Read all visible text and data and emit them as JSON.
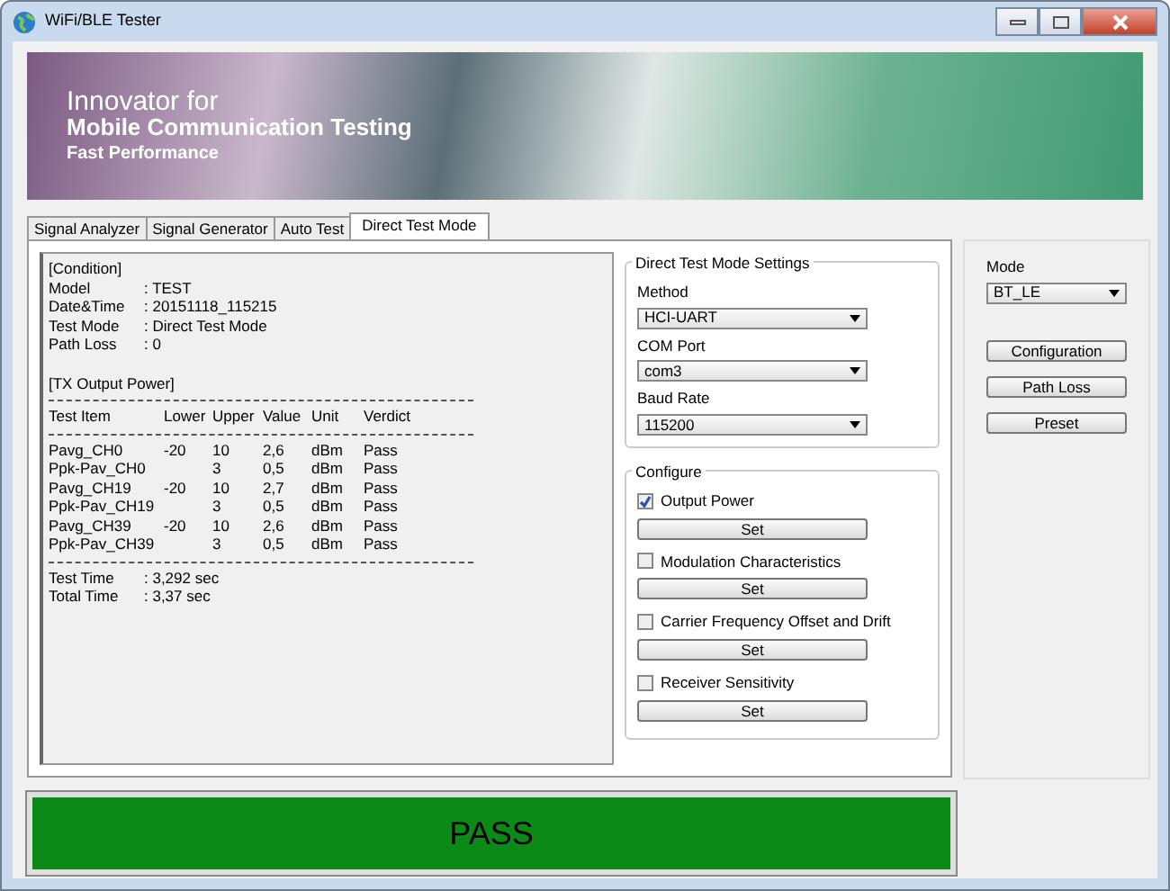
{
  "window": {
    "title": "WiFi/BLE Tester"
  },
  "banner": {
    "lines": [
      "Innovator for",
      "Mobile Communication Testing",
      "Fast Performance"
    ]
  },
  "tabs": [
    {
      "label": "Signal Analyzer",
      "selected": false
    },
    {
      "label": "Signal Generator",
      "selected": false
    },
    {
      "label": "Auto Test",
      "selected": false
    },
    {
      "label": "Direct Test Mode",
      "selected": true
    }
  ],
  "report": {
    "header": "[Condition]",
    "fields": [
      {
        "label": "Model",
        "value": ": TEST"
      },
      {
        "label": "Date&Time",
        "value": ": 20151118_115215"
      },
      {
        "label": "Test Mode",
        "value": ": Direct Test Mode"
      },
      {
        "label": "Path Loss",
        "value": ": 0"
      }
    ],
    "section": "[TX Output Power]",
    "columns": [
      "Test Item",
      "Lower",
      "Upper",
      "Value",
      "Unit",
      "Verdict"
    ],
    "rows": [
      [
        "Pavg_CH0",
        "-20",
        "10",
        "2,6",
        "dBm",
        "Pass"
      ],
      [
        "Ppk-Pav_CH0",
        "",
        "3",
        "0,5",
        "dBm",
        "Pass"
      ],
      [
        "Pavg_CH19",
        "-20",
        "10",
        "2,7",
        "dBm",
        "Pass"
      ],
      [
        "Ppk-Pav_CH19",
        "",
        "3",
        "0,5",
        "dBm",
        "Pass"
      ],
      [
        "Pavg_CH39",
        "-20",
        "10",
        "2,6",
        "dBm",
        "Pass"
      ],
      [
        "Ppk-Pav_CH39",
        "",
        "3",
        "0,5",
        "dBm",
        "Pass"
      ]
    ],
    "times": [
      {
        "label": "Test Time",
        "value": ": 3,292 sec"
      },
      {
        "label": "Total Time",
        "value": ": 3,37 sec"
      }
    ]
  },
  "settings": {
    "title": "Direct Test Mode Settings",
    "dropdowns": [
      {
        "label": "Method",
        "value": "HCI-UART"
      },
      {
        "label": "COM Port",
        "value": "com3"
      },
      {
        "label": "Baud Rate",
        "value": "115200"
      }
    ]
  },
  "configure": {
    "title": "Configure",
    "items": [
      {
        "label": "Output Power",
        "checked": true,
        "button": "Set"
      },
      {
        "label": "Modulation Characteristics",
        "checked": false,
        "button": "Set"
      },
      {
        "label": "Carrier Frequency Offset and Drift",
        "checked": false,
        "button": "Set"
      },
      {
        "label": "Receiver Sensitivity",
        "checked": false,
        "button": "Set"
      }
    ]
  },
  "mode": {
    "label": "Mode",
    "value": "BT_LE",
    "buttons": [
      "Configuration",
      "Path Loss",
      "Preset"
    ]
  },
  "result": {
    "text": "PASS"
  }
}
